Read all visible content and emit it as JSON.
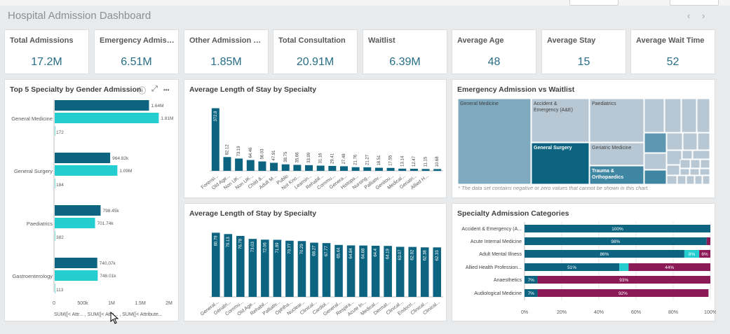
{
  "app": {
    "title": "Hospital Admission Dashboard",
    "prev": "‹",
    "next": "›"
  },
  "kpis": [
    {
      "label": "Total Admissions",
      "value": "17.2M"
    },
    {
      "label": "Emergency Admission",
      "value": "6.51M"
    },
    {
      "label": "Other Admission Met...",
      "value": "1.85M"
    },
    {
      "label": "Total Consultation",
      "value": "20.91M"
    },
    {
      "label": "Waitlist",
      "value": "6.39M"
    },
    {
      "label": "Average Age",
      "value": "48"
    },
    {
      "label": "Average Stay",
      "value": "15"
    },
    {
      "label": "Average Wait Time",
      "value": "52"
    }
  ],
  "colors": {
    "dark": "#0d6480",
    "teal": "#24cdd0",
    "magenta": "#8b1a57",
    "treemap_light": "#b7c8d4",
    "cursor": "#000000"
  },
  "icons": {
    "info": "ⓘ",
    "expand": "⤢",
    "more": "•••"
  },
  "gender_chart": {
    "title": "Top 5 Specialty by Gender Admission",
    "x_ticks": [
      "0",
      "500k",
      "1M",
      "1.5M",
      "2M"
    ],
    "legend_text": "SUM([< Attr... , SUM([< Attri... , SUM([< Attribute...",
    "chart_data": {
      "type": "bar",
      "orientation": "horizontal",
      "categories": [
        "General Medicine",
        "General Surgery",
        "Paediatrics",
        "Gastroenterology"
      ],
      "series": [
        {
          "values": [
            1640000,
            964820,
            798450,
            740070
          ],
          "labels": [
            "1.64M",
            "964.82k",
            "798.45k",
            "740.07k"
          ]
        },
        {
          "values": [
            1810000,
            1090000,
            701740,
            748010
          ],
          "labels": [
            "1.81M",
            "1.09M",
            "701.74k",
            "748.01k"
          ]
        },
        {
          "values": [
            172,
            184,
            382,
            113
          ],
          "labels": [
            "172",
            "184",
            "382",
            "113"
          ]
        }
      ],
      "xlim": [
        0,
        2000000
      ]
    }
  },
  "stay_chart_1": {
    "title": "Average Length of Stay by Specialty",
    "chart_data": {
      "type": "bar",
      "categories": [
        "Forensi...",
        "Old Age...",
        "Non UK...",
        "Non UK...",
        "Child &...",
        "Adult M...",
        "Public",
        "Not Kno...",
        "Learnin...",
        "Rehabil...",
        "Commu...",
        "Genera...",
        "Histopa...",
        "Nursing...",
        "Palliativ...",
        "Genitou...",
        "Medical...",
        "Geriatri...",
        "Allied H..."
      ],
      "values": [
        372.8,
        82.12,
        73.19,
        64.46,
        56.03,
        47.91,
        38.75,
        35.66,
        33.99,
        31.16,
        29.41,
        27.48,
        21.76,
        21.27,
        18.51,
        17.55,
        13.14,
        12.47,
        11.15,
        10.68
      ],
      "value_labels": [
        "372.8",
        "82.12",
        "73.19",
        "64.46",
        "56.03",
        "47.91",
        "38.75",
        "35.66",
        "33.99",
        "31.16",
        "29.41",
        "27.48",
        "21.76",
        "21.27",
        "18.51",
        "17.55",
        "13.14",
        "12.47",
        "11.15",
        "10.68"
      ],
      "ylim": [
        0,
        400
      ]
    }
  },
  "stay_chart_2": {
    "title": "Average Length of Stay by Specialty",
    "chart_data": {
      "type": "bar",
      "categories": [
        "General...",
        "Geriatri...",
        "Commu...",
        "Old Age...",
        "Rehabil...",
        "Palliativ...",
        "Ophtha...",
        "Nuclear...",
        "Clinical...",
        "Cardiol...",
        "General...",
        "Respira...",
        "Acute In...",
        "Medical...",
        "Dermat...",
        "Clinical...",
        "Endocri...",
        "Clinical...",
        "Clinical..."
      ],
      "values": [
        80.79,
        79.13,
        76.78,
        73.03,
        72.06,
        71.89,
        70.77,
        70.29,
        68.27,
        67.77,
        65.44,
        64.84,
        64.68,
        64.4,
        64.19,
        63.07,
        62.92,
        62.38,
        62.33
      ],
      "value_labels": [
        "80.79",
        "79.13",
        "76.78",
        "73.03",
        "72.06",
        "71.89",
        "70.77",
        "70.29",
        "68.27",
        "67.77",
        "65.44",
        "64.84",
        "64.68",
        "64.4",
        "64.19",
        "63.07",
        "62.92",
        "62.38",
        "62.33"
      ],
      "ylim": [
        0,
        82
      ]
    }
  },
  "treemap": {
    "title": "Emergency Admission vs Waitlist",
    "note": "* The data set contains negative or zero values that cannot be shown in this chart.",
    "labels": [
      "General Medicine",
      "Accident & Emergency (A&E)",
      "Paediatrics",
      "General Surgery",
      "Geriatric Medicine",
      "Trauma & Orthopaedics"
    ]
  },
  "stacked_chart": {
    "title": "Specialty Admission Categories",
    "x_ticks": [
      "0%",
      "20%",
      "40%",
      "60%",
      "80%",
      "100%"
    ],
    "chart_data": {
      "type": "bar",
      "stacked": true,
      "orientation": "horizontal",
      "categories": [
        "Accident & Emergency (A...",
        "Acute Internal Medicine",
        "Adult Mental Illness",
        "Allied Health Profession...",
        "Anaesthetics",
        "Audiological Medicine"
      ],
      "series": [
        {
          "values": [
            100,
            98,
            86,
            51,
            7,
            7
          ],
          "labels": [
            "100%",
            "98%",
            "86%",
            "51%",
            "7%",
            "7%"
          ]
        },
        {
          "values": [
            0,
            0,
            8,
            5,
            0,
            0
          ],
          "labels": [
            "",
            "",
            "8%",
            "",
            "",
            ""
          ]
        },
        {
          "values": [
            0,
            2,
            6,
            44,
            93,
            92
          ],
          "labels": [
            "",
            "",
            "6%",
            "44%",
            "93%",
            "92%"
          ]
        }
      ],
      "xlim": [
        0,
        100
      ]
    }
  }
}
